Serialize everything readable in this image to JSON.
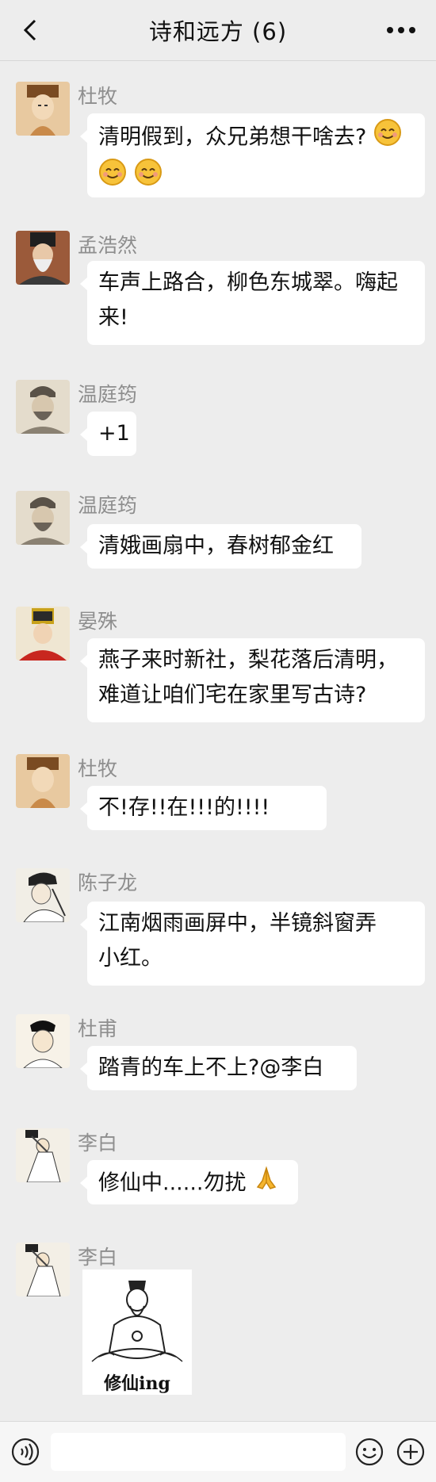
{
  "header": {
    "title": "诗和远方 (6)"
  },
  "messages": [
    {
      "sender": "杜牧",
      "text": "清明假到，众兄弟想干啥去?",
      "text2": "",
      "emoji_count": 3
    },
    {
      "sender": "孟浩然",
      "text": "车声上路合，柳色东城翠。嗨起",
      "text2": "来!"
    },
    {
      "sender": "温庭筠",
      "text": "+1"
    },
    {
      "sender": "温庭筠",
      "text": "清娥画扇中，春树郁金红"
    },
    {
      "sender": "晏殊",
      "text": "燕子来时新社，梨花落后清明，",
      "text2": "难道让咱们宅在家里写古诗?"
    },
    {
      "sender": "杜牧",
      "text": "不!存!!在!!!的!!!!"
    },
    {
      "sender": "陈子龙",
      "text": "江南烟雨画屏中，半镜斜窗弄",
      "text2": "小红。"
    },
    {
      "sender": "杜甫",
      "text": "踏青的车上不上?@李白"
    },
    {
      "sender": "李白",
      "text": "修仙中......勿扰"
    },
    {
      "sender": "李白",
      "sticker_caption": "修仙ing"
    }
  ],
  "icons": {
    "back": "chevron-left-icon",
    "more": "more-dots-icon",
    "voice": "voice-icon",
    "emoji": "emoji-icon",
    "plus": "plus-icon",
    "prayer": "praying-hands-icon",
    "smile": "smiling-face-icon"
  }
}
